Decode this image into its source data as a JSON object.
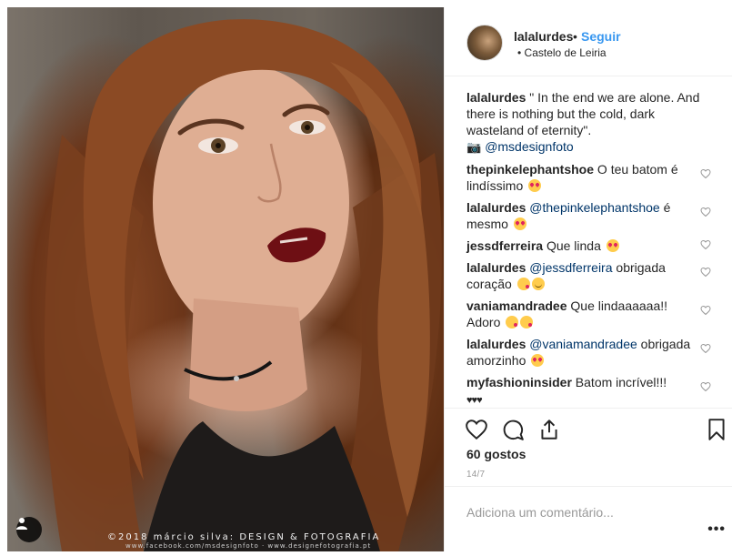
{
  "photo": {
    "credit": "©2018 márcio silva: DESIGN & FOTOGRAFIA",
    "credit_sub": "www.facebook.com/msdesignfoto · www.designefotografia.pt"
  },
  "header": {
    "username": "lalalurdes",
    "dot": "•",
    "follow": "Seguir",
    "location": "• Castelo de Leiria"
  },
  "caption": {
    "user": "lalalurdes",
    "text": " \" In the end we are alone. And there is nothing but the cold, dark wasteland of eternity\".",
    "mention": "@msdesignfoto"
  },
  "comments": [
    {
      "user": "thepinkelephantshoe",
      "text": " O teu batom é lindíssimo",
      "emojis": [
        "heart-eyes"
      ]
    },
    {
      "user": "lalalurdes",
      "mention": "@thepinkelephantshoe",
      "text": " é mesmo",
      "emojis": [
        "heart-eyes"
      ]
    },
    {
      "user": "jessdferreira",
      "text": " Que linda",
      "emojis": [
        "heart-eyes"
      ]
    },
    {
      "user": "lalalurdes",
      "mention": "@jessdferreira",
      "text": " obrigada coração",
      "emojis": [
        "kiss",
        "smile"
      ]
    },
    {
      "user": "vaniamandradee",
      "text": " Que lindaaaaaa!! Adoro",
      "emojis": [
        "kiss",
        "kiss"
      ]
    },
    {
      "user": "lalalurdes",
      "mention": "@vaniamandradee",
      "text": " obrigada amorzinho",
      "emojis": [
        "heart-eyes"
      ]
    },
    {
      "user": "myfashioninsider",
      "text": " Batom incrível!!!",
      "extra": "♥♥♥"
    }
  ],
  "likes": "60 gostos",
  "date": "14/7",
  "add_comment": {
    "placeholder": "Adiciona um comentário..."
  },
  "more": "•••",
  "colors": {
    "link": "#3897f0",
    "mention": "#003569",
    "muted": "#999999"
  }
}
